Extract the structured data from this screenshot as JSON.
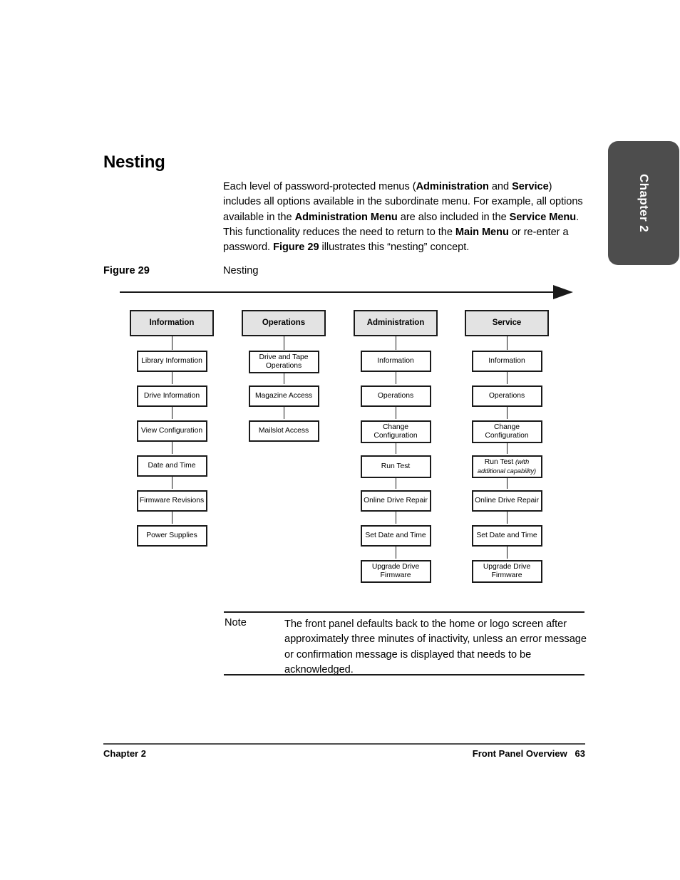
{
  "chapter_tab": {
    "label": "Chapter 2"
  },
  "section": {
    "heading": "Nesting"
  },
  "intro": {
    "p1_a": "Each level of password-protected menus (",
    "p1_b": "Administration",
    "p1_c": " and ",
    "p1_d": "Service",
    "p1_e": ") includes all options available in the subordinate menu. For example, all options available in the ",
    "p1_f": "Administration Menu",
    "p1_g": " are also included in the ",
    "p1_h": "Service Menu",
    "p1_i": ". This functionality reduces the need to return to the ",
    "p1_j": "Main Menu",
    "p1_k": " or re-enter a password. ",
    "p1_l": "Figure 29",
    "p1_m": " illustrates this “nesting” concept."
  },
  "figure": {
    "label": "Figure 29",
    "title": "Nesting"
  },
  "diagram": {
    "arrow_direction": "right",
    "header_fill": "#e3e3e3",
    "border_color": "#1a1a1a",
    "columns": [
      {
        "header": "Information",
        "items": [
          {
            "line1": "Library Information"
          },
          {
            "line1": "Drive Information"
          },
          {
            "line1": "View Configuration"
          },
          {
            "line1": "Date and Time"
          },
          {
            "line1": "Firmware Revisions"
          },
          {
            "line1": "Power Supplies"
          }
        ]
      },
      {
        "header": "Operations",
        "items": [
          {
            "line1": "Drive and Tape",
            "line2": "Operations"
          },
          {
            "line1": "Magazine Access"
          },
          {
            "line1": "Mailslot Access"
          }
        ]
      },
      {
        "header": "Administration",
        "items": [
          {
            "line1": "Information"
          },
          {
            "line1": "Operations"
          },
          {
            "line1": "Change",
            "line2": "Configuration"
          },
          {
            "line1": "Run Test"
          },
          {
            "line1": "Online Drive Repair"
          },
          {
            "line1": "Set Date and Time"
          },
          {
            "line1": "Upgrade Drive",
            "line2": "Firmware"
          }
        ]
      },
      {
        "header": "Service",
        "items": [
          {
            "line1": "Information"
          },
          {
            "line1": "Operations"
          },
          {
            "line1": "Change",
            "line2": "Configuration"
          },
          {
            "line1": "Run Test ",
            "italic1": "(with",
            "italic2": "additional capability)"
          },
          {
            "line1": "Online Drive Repair"
          },
          {
            "line1": "Set Date and Time"
          },
          {
            "line1": "Upgrade Drive",
            "line2": "Firmware"
          }
        ]
      }
    ]
  },
  "note": {
    "label": "Note",
    "text": "The front panel defaults back to the home or logo screen after approximately three minutes of inactivity, unless an error message or confirmation message is displayed that needs to be acknowledged."
  },
  "footer": {
    "left": "Chapter 2",
    "right": "Front Panel Overview",
    "page": "63"
  }
}
